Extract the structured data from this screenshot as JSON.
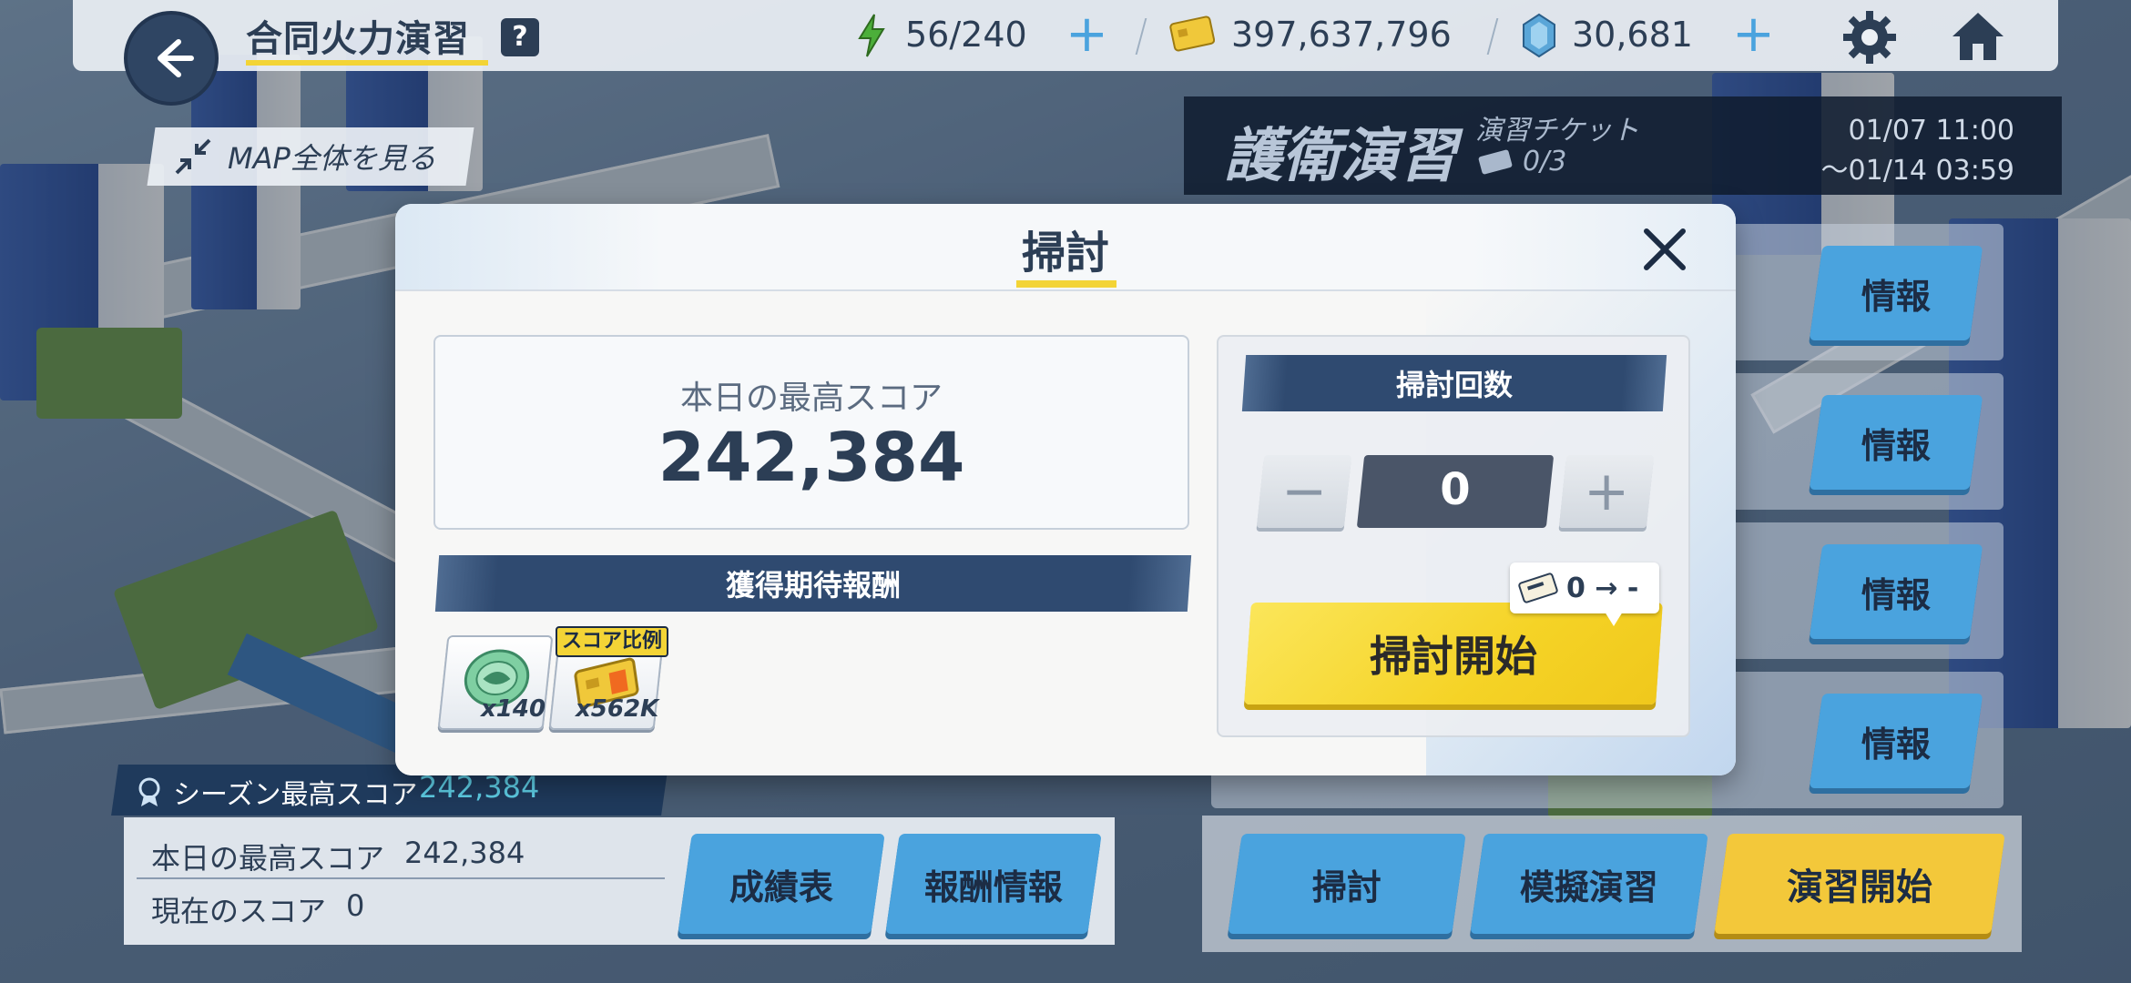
{
  "topbar": {
    "title": "合同火力演習",
    "help": "?",
    "stamina": "56/240",
    "credits": "397,637,796",
    "gems": "30,681"
  },
  "map_view_button": "MAP全体を見る",
  "event": {
    "title": "護衛演習",
    "ticket_label": "演習チケット",
    "ticket_count": "0/3",
    "period_start": "01/07 11:00",
    "period_end": "〜01/14 03:59"
  },
  "info_buttons": [
    "情報",
    "情報",
    "情報",
    "情報"
  ],
  "season": {
    "best_label": "シーズン最高スコア",
    "best_value": "242,384",
    "today_label": "本日の最高スコア",
    "today_value": "242,384",
    "current_label": "現在のスコア",
    "current_value": "0"
  },
  "bottom_buttons": {
    "results": "成績表",
    "rewards_info": "報酬情報",
    "sweep": "掃討",
    "mock": "模擬演習",
    "start": "演習開始"
  },
  "modal": {
    "title": "掃討",
    "today_best_label": "本日の最高スコア",
    "today_best_value": "242,384",
    "expected_rewards_label": "獲得期待報酬",
    "rewards": [
      {
        "icon": "coin-icon",
        "qty": "x140"
      },
      {
        "icon": "credit-card-icon",
        "qty": "x562K",
        "tag": "スコア比例"
      }
    ],
    "sweep_count_label": "掃討回数",
    "minus": "−",
    "plus": "+",
    "count_value": "0",
    "ticket_cost": "0 → -",
    "start_label": "掃討開始"
  },
  "colors": {
    "accent_yellow": "#f3d436",
    "navy": "#2c3e55",
    "blue_button": "#4aa3de"
  }
}
